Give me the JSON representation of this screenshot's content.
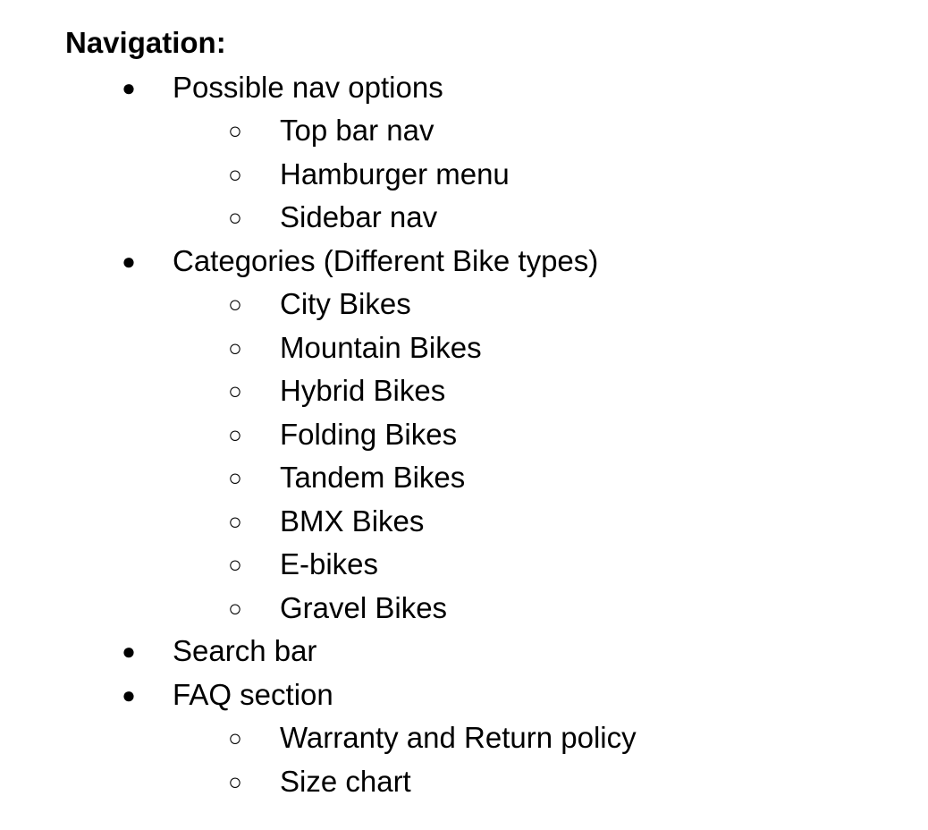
{
  "document": {
    "heading": "Navigation:",
    "bullet_glyph": "●",
    "sub_bullet_glyph": "○",
    "items": [
      {
        "level": 1,
        "text": "Possible nav options"
      },
      {
        "level": 2,
        "text": "Top bar nav"
      },
      {
        "level": 2,
        "text": "Hamburger menu"
      },
      {
        "level": 2,
        "text": "Sidebar nav"
      },
      {
        "level": 1,
        "text": "Categories (Different Bike types)"
      },
      {
        "level": 2,
        "text": "City Bikes"
      },
      {
        "level": 2,
        "text": "Mountain Bikes"
      },
      {
        "level": 2,
        "text": "Hybrid Bikes"
      },
      {
        "level": 2,
        "text": "Folding Bikes"
      },
      {
        "level": 2,
        "text": "Tandem Bikes"
      },
      {
        "level": 2,
        "text": "BMX Bikes"
      },
      {
        "level": 2,
        "text": "E-bikes"
      },
      {
        "level": 2,
        "text": "Gravel Bikes"
      },
      {
        "level": 1,
        "text": "Search bar"
      },
      {
        "level": 1,
        "text": "FAQ section"
      },
      {
        "level": 2,
        "text": "Warranty and Return policy"
      },
      {
        "level": 2,
        "text": "Size chart"
      }
    ]
  }
}
